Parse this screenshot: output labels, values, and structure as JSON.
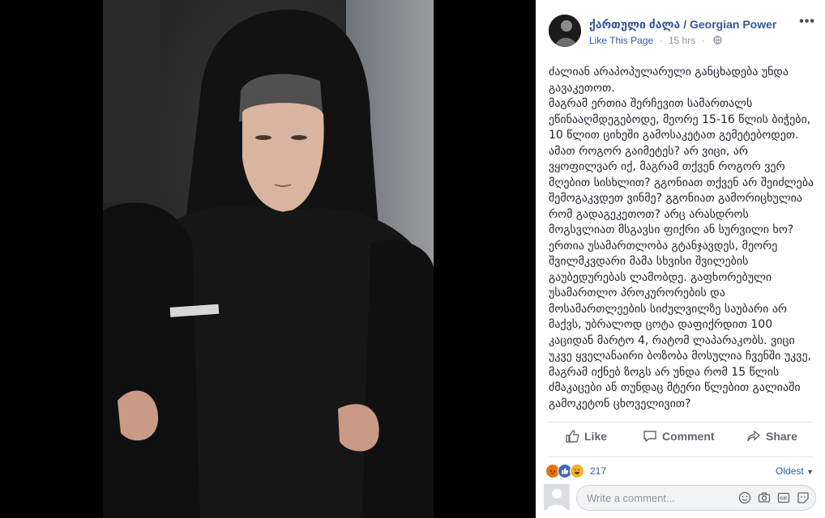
{
  "post": {
    "page_name": "ქართული ძალა / Georgian Power",
    "like_page": "Like This Page",
    "time": "15 hrs",
    "more_label": "•••",
    "text": "ძალიან არაპოპულარული განცხადება უნდა გავაკეთოთ.\nმაგრამ ერთია შერჩევით სამართალს ეწინააღმდეგებოდე, მეორე 15-16 წლის ბიჭები, 10 წლით ციხეში გამოსაკეტათ გემეტებოდეთ. ამათ როგორ გაიმეტეს? არ ვიცი, არ ვყოფილვარ იქ, მაგრამ თქვენ როგორ ვერ მღებით სისხლით? გგონიათ თქვენ არ შეიძლება შემოგაკვდეთ ვინმე? გგონიათ გამორიცხულია რომ გადაგეკეთოთ? არც არასდროს მოგსვლიათ მსგავსი ფიქრი ან სურვილი ხო? ერთია უსამართლობა გტანჯავდეს, მეორე შვილმკვდარი მამა სხვისი შვილების გაუბედურებას ლამობდე. გაფხორებული უსამართლო პროკურორების და მოსამართლეების სიძულვილზე საუბარი არ მაქვს, უბრალოდ ცოტა დაფიქრდით 100 კაციდან მარტო 4, რატომ ლაპარაკობს. ვიცი უკვე ყველანაირი ბოზობა მოსულია ჩვენში უკვე, მაგრამ იქნებ ზოგს არ უნდა რომ 15 წლის ძმაკაცები ან თუნდაც მტერი წლებით გალიაში გამოკეტონ ცხოველივით?"
  },
  "actions": {
    "like": "Like",
    "comment": "Comment",
    "share": "Share"
  },
  "reactions": {
    "count": "217",
    "sort": "Oldest"
  },
  "composer": {
    "placeholder": "Write a comment..."
  },
  "icons": [
    "profile-photo",
    "globe-icon",
    "like-icon",
    "comment-icon",
    "share-icon",
    "angry-reaction",
    "like-reaction",
    "haha-reaction",
    "emoji-icon",
    "camera-icon",
    "gif-icon",
    "sticker-icon"
  ],
  "colors": {
    "link": "#365899",
    "muted": "#90949c",
    "text": "#1d2129",
    "angry": "#e9710f",
    "like_blue": "#4267b2",
    "haha": "#f7b125"
  }
}
